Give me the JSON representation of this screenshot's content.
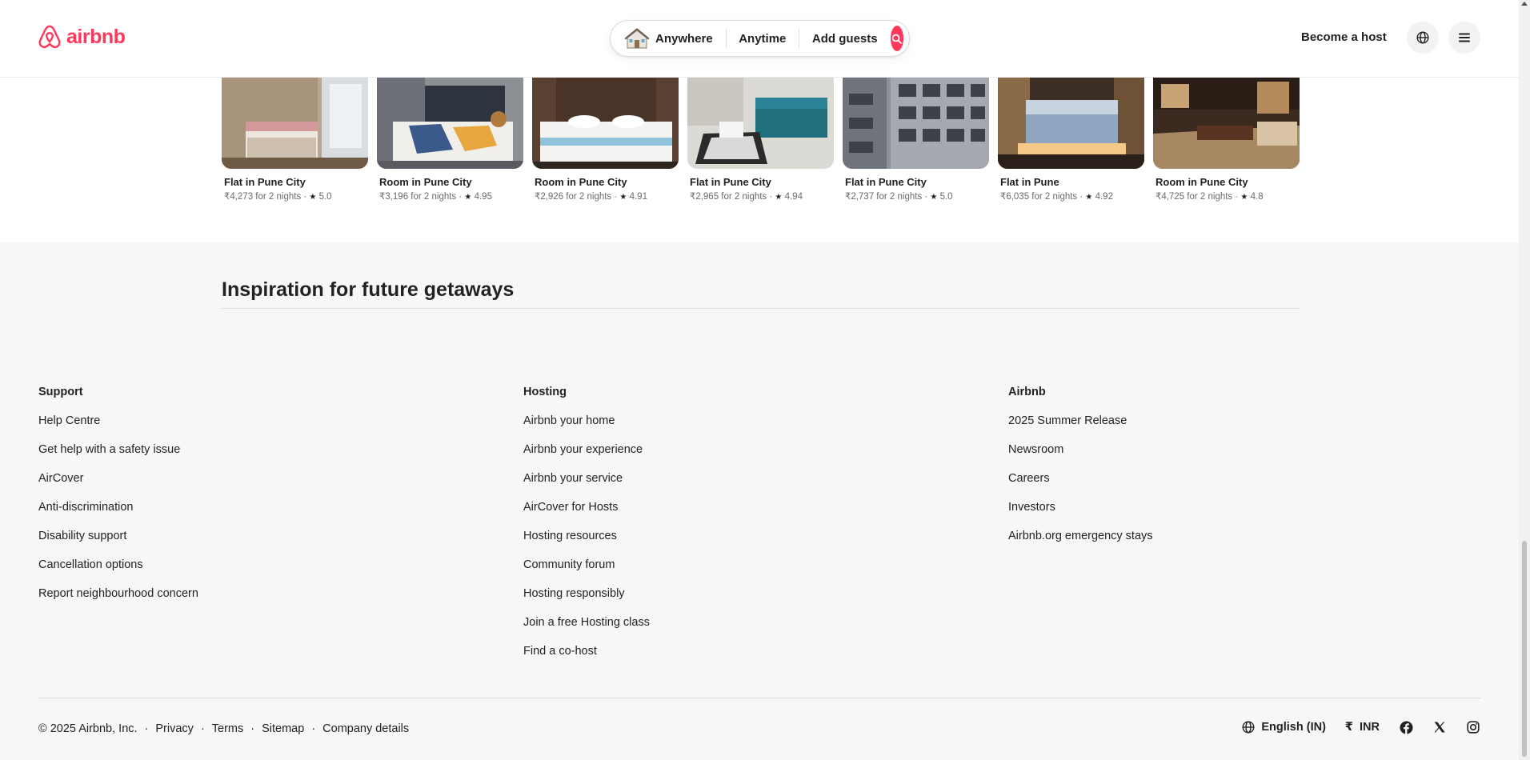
{
  "header": {
    "logo_text": "airbnb",
    "search": {
      "anywhere": "Anywhere",
      "anytime": "Anytime",
      "guests": "Add guests"
    },
    "become_host": "Become a host"
  },
  "listings": [
    {
      "title": "Flat in Pune City",
      "price": "₹4,273 for 2 nights",
      "rating": "5.0"
    },
    {
      "title": "Room in Pune City",
      "price": "₹3,196 for 2 nights",
      "rating": "4.95"
    },
    {
      "title": "Room in Pune City",
      "price": "₹2,926 for 2 nights",
      "rating": "4.91"
    },
    {
      "title": "Flat in Pune City",
      "price": "₹2,965 for 2 nights",
      "rating": "4.94"
    },
    {
      "title": "Flat in Pune City",
      "price": "₹2,737 for 2 nights",
      "rating": "5.0"
    },
    {
      "title": "Flat in Pune",
      "price": "₹6,035 for 2 nights",
      "rating": "4.92"
    },
    {
      "title": "Room in Pune City",
      "price": "₹4,725 for 2 nights",
      "rating": "4.8"
    }
  ],
  "inspiration": {
    "title": "Inspiration for future getaways"
  },
  "footer": {
    "support": {
      "title": "Support",
      "links": [
        "Help Centre",
        "Get help with a safety issue",
        "AirCover",
        "Anti-discrimination",
        "Disability support",
        "Cancellation options",
        "Report neighbourhood concern"
      ]
    },
    "hosting": {
      "title": "Hosting",
      "links": [
        "Airbnb your home",
        "Airbnb your experience",
        "Airbnb your service",
        "AirCover for Hosts",
        "Hosting resources",
        "Community forum",
        "Hosting responsibly",
        "Join a free Hosting class",
        "Find a co-host"
      ]
    },
    "airbnb": {
      "title": "Airbnb",
      "links": [
        "2025 Summer Release",
        "Newsroom",
        "Careers",
        "Investors",
        "Airbnb.org emergency stays"
      ]
    },
    "copyright": "© 2025 Airbnb, Inc.",
    "legal_links": [
      "Privacy",
      "Terms",
      "Sitemap",
      "Company details"
    ],
    "language": "English (IN)",
    "currency_symbol": "₹",
    "currency": "INR"
  },
  "colors": {
    "brand": "#ff385c",
    "text": "#222222",
    "muted": "#6a6a6a",
    "footer_bg": "#f7f7f7"
  },
  "icons": [
    "airbnb-logo-icon",
    "house-icon",
    "search-icon",
    "globe-icon",
    "hamburger-menu-icon",
    "star-icon",
    "facebook-icon",
    "x-icon",
    "instagram-icon"
  ]
}
